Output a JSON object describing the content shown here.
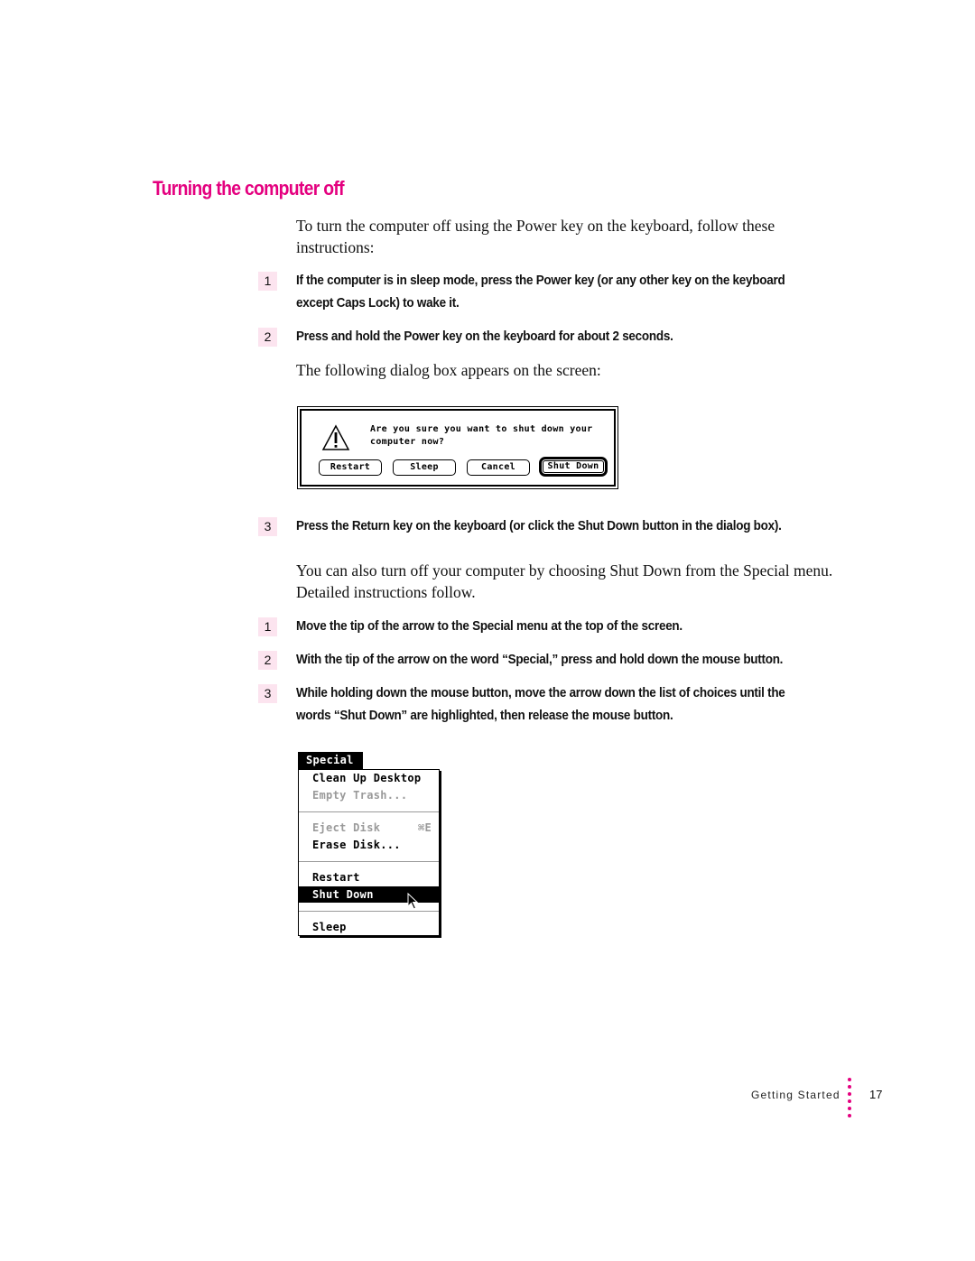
{
  "heading": "Turning the computer off",
  "intro_text": "To turn the computer off using the Power key on the keyboard, follow these instructions:",
  "steps_power_key": [
    {
      "number": "1",
      "text_line1": "If the computer is in sleep mode, press the Power key (or any other key on the keyboard",
      "text_line2": "except Caps Lock) to wake it."
    },
    {
      "number": "2",
      "text_line1": "Press and hold the Power key on the keyboard for about 2 seconds.",
      "text_line2": ""
    }
  ],
  "dialog_intro": "The following dialog box appears on the screen:",
  "dialog": {
    "icon": "warning-icon",
    "message": "Are you sure you want to shut down your\ncomputer now?",
    "buttons": [
      {
        "label": "Restart"
      },
      {
        "label": "Sleep"
      },
      {
        "label": "Cancel"
      },
      {
        "label": "Shut Down",
        "default": true
      }
    ]
  },
  "step_3_power_key": {
    "number": "3",
    "text": "Press the Return key on the keyboard (or click the Shut Down button in the dialog box)."
  },
  "alt_text": "You can also turn off your computer by choosing Shut Down from the Special menu. Detailed instructions follow.",
  "steps_menu": [
    {
      "number": "1",
      "text_line1": "Move the tip of the arrow to the Special menu at the top of the screen.",
      "text_line2": ""
    },
    {
      "number": "2",
      "text_line1": "With the tip of the arrow on the word “Special,” press and hold down the mouse button.",
      "text_line2": ""
    },
    {
      "number": "3",
      "text_line1": "While holding down the mouse button, move the arrow down the list of choices until the",
      "text_line2": "words “Shut Down” are highlighted, then release the mouse button."
    }
  ],
  "special_menu": {
    "title": "Special",
    "items": [
      {
        "label": "Clean Up Desktop",
        "state": "enabled"
      },
      {
        "label": "Empty Trash...",
        "state": "disabled"
      },
      {
        "label": "Eject Disk",
        "shortcut": "⌘E",
        "state": "disabled"
      },
      {
        "label": "Erase Disk...",
        "state": "enabled"
      },
      {
        "label": "Restart",
        "state": "enabled"
      },
      {
        "label": "Shut Down",
        "state": "selected"
      },
      {
        "label": "Sleep",
        "state": "enabled"
      }
    ]
  },
  "footer": {
    "section_label": "Getting Started",
    "page_number": "17",
    "accent_color": "#e4007f"
  },
  "colors": {
    "heading": "#e4007f",
    "step_badge_bg": "#fce4ef"
  }
}
